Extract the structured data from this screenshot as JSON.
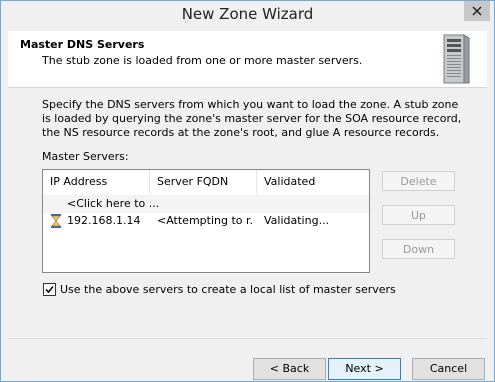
{
  "window": {
    "title": "New Zone Wizard"
  },
  "header": {
    "title": "Master DNS Servers",
    "subtitle": "The stub zone is loaded from one or more master servers.",
    "icon": "server-icon"
  },
  "main": {
    "description": "Specify the DNS servers from which you want to load the zone. A stub zone is loaded by querying the zone's master server for the SOA resource record, the NS resource records at the zone's root, and glue A resource records.",
    "masters_label": "Master Servers:",
    "columns": [
      "IP Address",
      "Server FQDN",
      "Validated"
    ],
    "placeholder_row": "<Click here to ...",
    "rows": [
      {
        "ip": "192.168.1.14",
        "fqdn": "<Attempting to r...",
        "validated": "Validating...",
        "icon": "hourglass-icon"
      }
    ],
    "side_buttons": {
      "delete": "Delete",
      "up": "Up",
      "down": "Down"
    },
    "checkbox": {
      "label": "Use the above servers to create a local list of master servers",
      "checked": true
    }
  },
  "footer": {
    "back": "< Back",
    "next": "Next >",
    "cancel": "Cancel"
  }
}
